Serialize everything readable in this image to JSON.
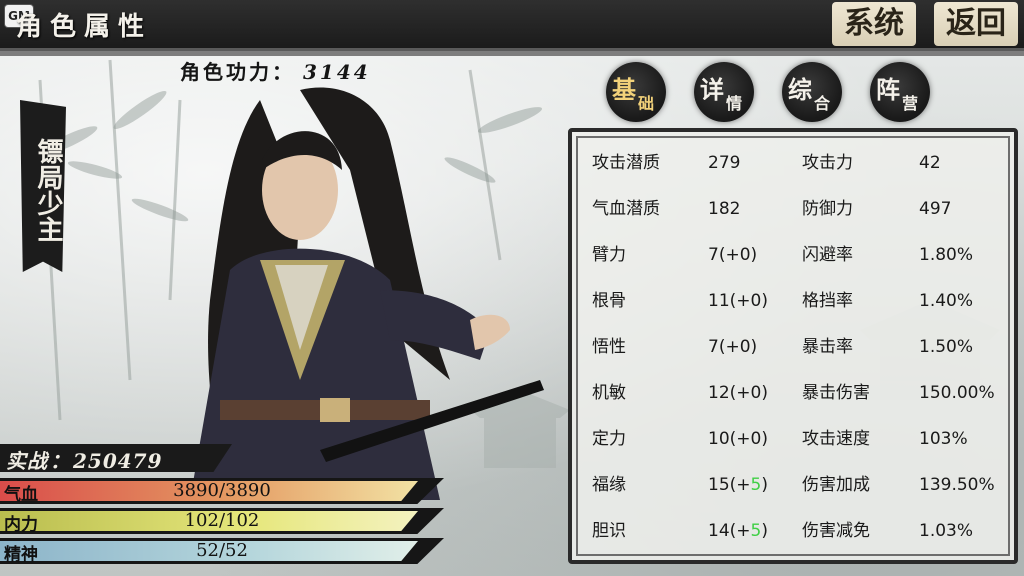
{
  "header": {
    "gm_badge": "GM",
    "title": "角色属性",
    "system_button": "系统",
    "back_button": "返回"
  },
  "power": {
    "label": "角色功力：",
    "value": "3144"
  },
  "character": {
    "title": "镖局少主"
  },
  "tabs": [
    {
      "main": "基",
      "sub": "础",
      "active": true
    },
    {
      "main": "详",
      "sub": "情",
      "active": false
    },
    {
      "main": "综",
      "sub": "合",
      "active": false
    },
    {
      "main": "阵",
      "sub": "营",
      "active": false
    }
  ],
  "stats": [
    {
      "label1": "攻击潜质",
      "value1": "279",
      "bonus1": "",
      "label2": "攻击力",
      "value2": "42"
    },
    {
      "label1": "气血潜质",
      "value1": "182",
      "bonus1": "",
      "label2": "防御力",
      "value2": "497"
    },
    {
      "label1": "臂力",
      "value1": "7(+0)",
      "bonus1": "",
      "label2": "闪避率",
      "value2": "1.80%"
    },
    {
      "label1": "根骨",
      "value1": "11(+0)",
      "bonus1": "",
      "label2": "格挡率",
      "value2": "1.40%"
    },
    {
      "label1": "悟性",
      "value1": "7(+0)",
      "bonus1": "",
      "label2": "暴击率",
      "value2": "1.50%"
    },
    {
      "label1": "机敏",
      "value1": "12(+0)",
      "bonus1": "",
      "label2": "暴击伤害",
      "value2": "150.00%"
    },
    {
      "label1": "定力",
      "value1": "10(+0)",
      "bonus1": "",
      "label2": "攻击速度",
      "value2": "103%"
    },
    {
      "label1": "福缘",
      "value1": "15(+",
      "bonus1": "5",
      "value1_end": ")",
      "label2": "伤害加成",
      "value2": "139.50%"
    },
    {
      "label1": "胆识",
      "value1": "14(+",
      "bonus1": "5",
      "value1_end": ")",
      "label2": "伤害减免",
      "value2": "1.03%"
    }
  ],
  "combat": {
    "label": "实战",
    "separator": "：",
    "value": "250479"
  },
  "bars": {
    "hp": {
      "label": "气血",
      "value": "3890/3890",
      "fill": 1.0
    },
    "mp": {
      "label": "内力",
      "value": "102/102",
      "fill": 1.0
    },
    "sp": {
      "label": "精神",
      "value": "52/52",
      "fill": 1.0
    }
  },
  "colors": {
    "bonus": "#3fcf45",
    "active_tab": "#f3d27a"
  }
}
